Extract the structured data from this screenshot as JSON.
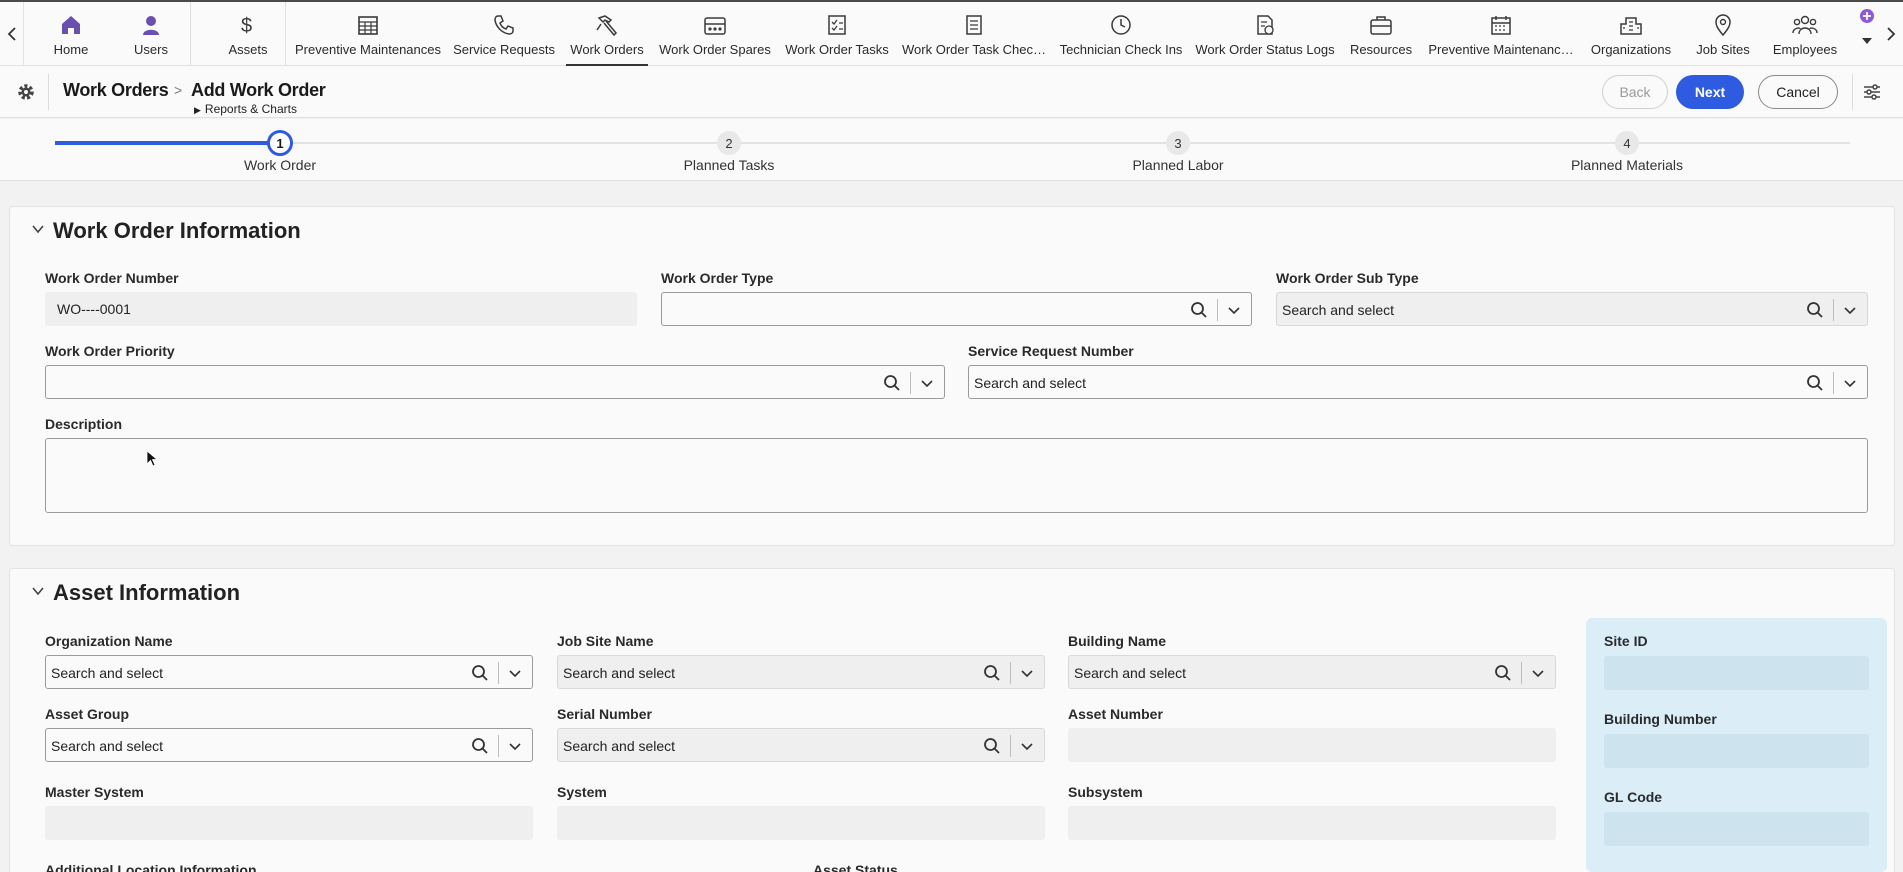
{
  "nav": {
    "items": [
      {
        "label": "Home",
        "icon": "home-icon"
      },
      {
        "label": "Users",
        "icon": "user-icon"
      },
      {
        "label": "Assets",
        "icon": "dollar-icon"
      },
      {
        "label": "Preventive Maintenances",
        "icon": "calendar-grid-icon"
      },
      {
        "label": "Service Requests",
        "icon": "phone-icon"
      },
      {
        "label": "Work Orders",
        "icon": "hammer-icon",
        "active": true
      },
      {
        "label": "Work Order Spares",
        "icon": "spares-icon"
      },
      {
        "label": "Work Order Tasks",
        "icon": "checklist-icon"
      },
      {
        "label": "Work Order Task Chec…",
        "icon": "document-list-icon"
      },
      {
        "label": "Technician Check Ins",
        "icon": "clock-icon"
      },
      {
        "label": "Work Order Status Logs",
        "icon": "status-log-icon"
      },
      {
        "label": "Resources",
        "icon": "briefcase-icon"
      },
      {
        "label": "Preventive Maintenanc…",
        "icon": "calendar-icon"
      },
      {
        "label": "Organizations",
        "icon": "building-icon"
      },
      {
        "label": "Job Sites",
        "icon": "location-pin-icon"
      },
      {
        "label": "Employees",
        "icon": "group-icon"
      }
    ]
  },
  "header": {
    "breadcrumb_root": "Work Orders",
    "breadcrumb_sep": ">",
    "title": "Add Work Order",
    "reports_label": "Reports & Charts",
    "back_label": "Back",
    "next_label": "Next",
    "cancel_label": "Cancel"
  },
  "stepper": {
    "steps": [
      {
        "number": "1",
        "label": "Work Order"
      },
      {
        "number": "2",
        "label": "Planned Tasks"
      },
      {
        "number": "3",
        "label": "Planned Labor"
      },
      {
        "number": "4",
        "label": "Planned Materials"
      }
    ],
    "current_step": 1
  },
  "work_order_info": {
    "title": "Work Order Information",
    "number_label": "Work Order Number",
    "number_value": "WO----0001",
    "type_label": "Work Order Type",
    "type_value": "",
    "subtype_label": "Work Order Sub Type",
    "subtype_placeholder": "Search and select",
    "priority_label": "Work Order Priority",
    "priority_value": "",
    "service_request_label": "Service Request Number",
    "service_request_placeholder": "Search and select",
    "description_label": "Description",
    "description_value": ""
  },
  "asset_info": {
    "title": "Asset Information",
    "org_label": "Organization Name",
    "org_placeholder": "Search and select",
    "jobsite_label": "Job Site Name",
    "jobsite_placeholder": "Search and select",
    "building_label": "Building Name",
    "building_placeholder": "Search and select",
    "asset_group_label": "Asset Group",
    "asset_group_placeholder": "Search and select",
    "serial_label": "Serial Number",
    "serial_placeholder": "Search and select",
    "asset_number_label": "Asset Number",
    "master_system_label": "Master System",
    "system_label": "System",
    "subsystem_label": "Subsystem",
    "additional_location_label": "Additional Location Information",
    "asset_status_label": "Asset Status",
    "site_id_label": "Site ID",
    "building_number_label": "Building Number",
    "gl_code_label": "GL Code"
  },
  "colors": {
    "accent": "#2e5be0",
    "nav_icon": "#3a3a3a",
    "home_icon": "#6a4fb0",
    "side_panel": "#dbeef8"
  }
}
